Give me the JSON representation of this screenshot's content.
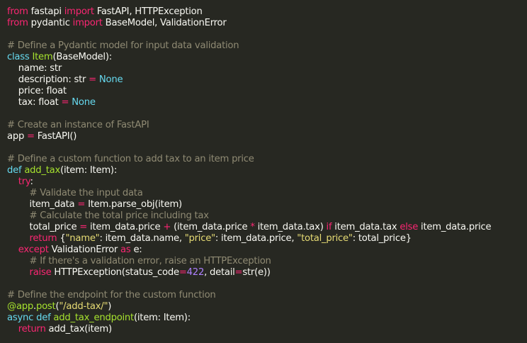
{
  "colors": {
    "background": "#272822",
    "text": "#f8f8f2",
    "keyword": "#f92672",
    "storage": "#66d9ef",
    "function_name": "#a6e22e",
    "comment": "#8f8a73",
    "string": "#e6db74",
    "number": "#ae81ff"
  },
  "code_lines": [
    [
      [
        "keyword",
        "from"
      ],
      [
        "text",
        " fastapi "
      ],
      [
        "keyword",
        "import"
      ],
      [
        "text",
        " FastAPI, HTTPException"
      ]
    ],
    [
      [
        "keyword",
        "from"
      ],
      [
        "text",
        " pydantic "
      ],
      [
        "keyword",
        "import"
      ],
      [
        "text",
        " BaseModel, ValidationError"
      ]
    ],
    [],
    [
      [
        "comment",
        "# Define a Pydantic model for input data validation"
      ]
    ],
    [
      [
        "storage",
        "class"
      ],
      [
        "text",
        " "
      ],
      [
        "class",
        "Item"
      ],
      [
        "text",
        "(BaseModel):"
      ]
    ],
    [
      [
        "text",
        "    name: str"
      ]
    ],
    [
      [
        "text",
        "    description: str "
      ],
      [
        "op",
        "="
      ],
      [
        "text",
        " "
      ],
      [
        "const",
        "None"
      ]
    ],
    [
      [
        "text",
        "    price: float"
      ]
    ],
    [
      [
        "text",
        "    tax: float "
      ],
      [
        "op",
        "="
      ],
      [
        "text",
        " "
      ],
      [
        "const",
        "None"
      ]
    ],
    [],
    [
      [
        "comment",
        "# Create an instance of FastAPI"
      ]
    ],
    [
      [
        "text",
        "app "
      ],
      [
        "op",
        "="
      ],
      [
        "text",
        " FastAPI()"
      ]
    ],
    [],
    [
      [
        "comment",
        "# Define a custom function to add tax to an item price"
      ]
    ],
    [
      [
        "storage",
        "def"
      ],
      [
        "text",
        " "
      ],
      [
        "func",
        "add_tax"
      ],
      [
        "text",
        "(item: Item):"
      ]
    ],
    [
      [
        "text",
        "    "
      ],
      [
        "keyword",
        "try"
      ],
      [
        "text",
        ":"
      ]
    ],
    [
      [
        "text",
        "        "
      ],
      [
        "comment",
        "# Validate the input data"
      ]
    ],
    [
      [
        "text",
        "        item_data "
      ],
      [
        "op",
        "="
      ],
      [
        "text",
        " Item.parse_obj(item)"
      ]
    ],
    [
      [
        "text",
        "        "
      ],
      [
        "comment",
        "# Calculate the total price including tax"
      ]
    ],
    [
      [
        "text",
        "        total_price "
      ],
      [
        "op",
        "="
      ],
      [
        "text",
        " item_data.price "
      ],
      [
        "op",
        "+"
      ],
      [
        "text",
        " (item_data.price "
      ],
      [
        "op",
        "*"
      ],
      [
        "text",
        " item_data.tax) "
      ],
      [
        "keyword",
        "if"
      ],
      [
        "text",
        " item_data.tax "
      ],
      [
        "keyword",
        "else"
      ],
      [
        "text",
        " item_data.price"
      ]
    ],
    [
      [
        "text",
        "        "
      ],
      [
        "keyword",
        "return"
      ],
      [
        "text",
        " {"
      ],
      [
        "string",
        "\"name\""
      ],
      [
        "text",
        ": item_data.name, "
      ],
      [
        "string",
        "\"price\""
      ],
      [
        "text",
        ": item_data.price, "
      ],
      [
        "string",
        "\"total_price\""
      ],
      [
        "text",
        ": total_price}"
      ]
    ],
    [
      [
        "text",
        "    "
      ],
      [
        "keyword",
        "except"
      ],
      [
        "text",
        " ValidationError "
      ],
      [
        "keyword",
        "as"
      ],
      [
        "text",
        " e:"
      ]
    ],
    [
      [
        "text",
        "        "
      ],
      [
        "comment",
        "# If there's a validation error, raise an HTTPException"
      ]
    ],
    [
      [
        "text",
        "        "
      ],
      [
        "keyword",
        "raise"
      ],
      [
        "text",
        " HTTPException(status_code"
      ],
      [
        "op",
        "="
      ],
      [
        "number",
        "422"
      ],
      [
        "text",
        ", detail"
      ],
      [
        "op",
        "="
      ],
      [
        "text",
        "str(e))"
      ]
    ],
    [],
    [
      [
        "comment",
        "# Define the endpoint for the custom function"
      ]
    ],
    [
      [
        "decorator",
        "@app"
      ],
      [
        "text",
        "."
      ],
      [
        "decorator",
        "post"
      ],
      [
        "text",
        "("
      ],
      [
        "string",
        "\"/add-tax/\""
      ],
      [
        "text",
        ")"
      ]
    ],
    [
      [
        "storage",
        "async"
      ],
      [
        "text",
        " "
      ],
      [
        "storage",
        "def"
      ],
      [
        "text",
        " "
      ],
      [
        "func",
        "add_tax_endpoint"
      ],
      [
        "text",
        "(item: Item):"
      ]
    ],
    [
      [
        "text",
        "    "
      ],
      [
        "keyword",
        "return"
      ],
      [
        "text",
        " add_tax(item)"
      ]
    ]
  ]
}
